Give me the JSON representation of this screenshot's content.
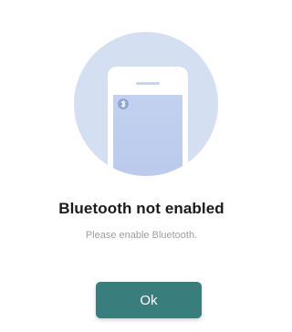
{
  "dialog": {
    "illustration_icon": "phone-bluetooth-illustration",
    "bluetooth_icon": "bluetooth-icon",
    "title": "Bluetooth not enabled",
    "message": "Please enable Bluetooth.",
    "ok_label": "Ok"
  },
  "colors": {
    "accent": "#3a7d7d",
    "illustration_circle": "#d4dff1",
    "phone_screen": "#c5d3ee",
    "bluetooth_badge": "#8fa6d6"
  }
}
